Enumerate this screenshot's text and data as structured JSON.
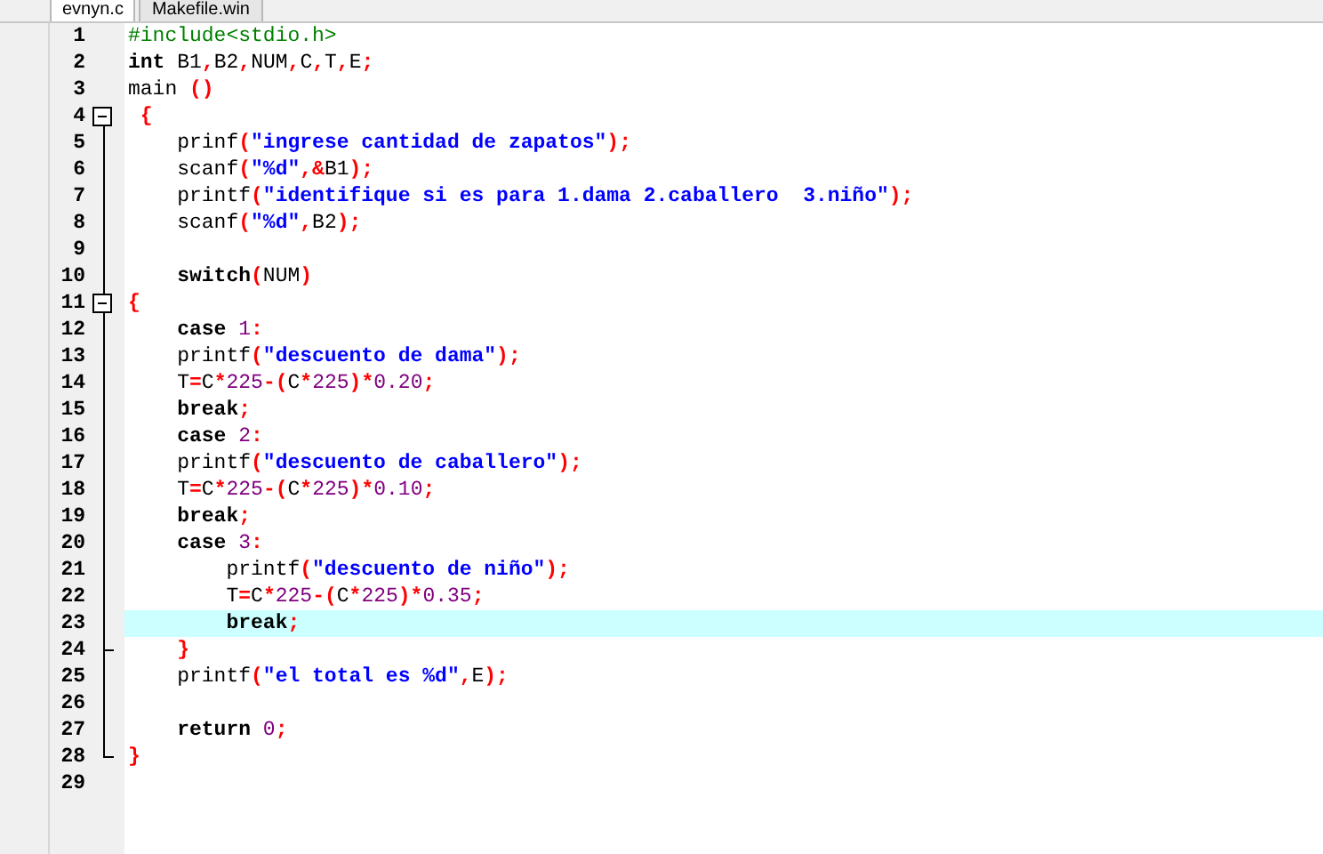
{
  "tabs": [
    {
      "label": "evnyn.c",
      "selected": true
    },
    {
      "label": "Makefile.win",
      "selected": false
    }
  ],
  "editor": {
    "lines": [
      {
        "number": "1",
        "kind": "code",
        "highlighted": false,
        "tokens": [
          {
            "kind": "preproc",
            "text": "#include<stdio.h>"
          }
        ]
      },
      {
        "number": "2",
        "kind": "code",
        "highlighted": false,
        "tokens": [
          {
            "kind": "keyword",
            "text": "int"
          },
          {
            "kind": "plain",
            "text": " B1"
          },
          {
            "kind": "symbol",
            "text": ","
          },
          {
            "kind": "plain",
            "text": "B2"
          },
          {
            "kind": "symbol",
            "text": ","
          },
          {
            "kind": "plain",
            "text": "NUM"
          },
          {
            "kind": "symbol",
            "text": ","
          },
          {
            "kind": "plain",
            "text": "C"
          },
          {
            "kind": "symbol",
            "text": ","
          },
          {
            "kind": "plain",
            "text": "T"
          },
          {
            "kind": "symbol",
            "text": ","
          },
          {
            "kind": "plain",
            "text": "E"
          },
          {
            "kind": "symbol",
            "text": ";"
          }
        ]
      },
      {
        "number": "3",
        "kind": "code",
        "highlighted": false,
        "tokens": [
          {
            "kind": "plain",
            "text": "main "
          },
          {
            "kind": "symbol",
            "text": "()"
          }
        ]
      },
      {
        "number": "4",
        "kind": "fold_start",
        "highlighted": false,
        "tokens": [
          {
            "kind": "symbol",
            "text": " {"
          }
        ]
      },
      {
        "number": "5",
        "kind": "code",
        "highlighted": false,
        "tokens": [
          {
            "kind": "plain",
            "text": "    prinf"
          },
          {
            "kind": "symbol",
            "text": "("
          },
          {
            "kind": "string",
            "text": "\"ingrese cantidad de zapatos\""
          },
          {
            "kind": "symbol",
            "text": ");"
          }
        ]
      },
      {
        "number": "6",
        "kind": "code",
        "highlighted": false,
        "tokens": [
          {
            "kind": "plain",
            "text": "    scanf"
          },
          {
            "kind": "symbol",
            "text": "("
          },
          {
            "kind": "string",
            "text": "\"%d\""
          },
          {
            "kind": "symbol",
            "text": ",&"
          },
          {
            "kind": "plain",
            "text": "B1"
          },
          {
            "kind": "symbol",
            "text": ");"
          }
        ]
      },
      {
        "number": "7",
        "kind": "code",
        "highlighted": false,
        "tokens": [
          {
            "kind": "plain",
            "text": "    printf"
          },
          {
            "kind": "symbol",
            "text": "("
          },
          {
            "kind": "string",
            "text": "\"identifique si es para 1.dama 2.caballero  3.niño\""
          },
          {
            "kind": "symbol",
            "text": ");"
          }
        ]
      },
      {
        "number": "8",
        "kind": "code",
        "highlighted": false,
        "tokens": [
          {
            "kind": "plain",
            "text": "    scanf"
          },
          {
            "kind": "symbol",
            "text": "("
          },
          {
            "kind": "string",
            "text": "\"%d\""
          },
          {
            "kind": "symbol",
            "text": ","
          },
          {
            "kind": "plain",
            "text": "B2"
          },
          {
            "kind": "symbol",
            "text": ");"
          }
        ]
      },
      {
        "number": "9",
        "kind": "code",
        "highlighted": false
      },
      {
        "number": "10",
        "kind": "code",
        "highlighted": false,
        "tokens": [
          {
            "kind": "keyword",
            "text": "    switch"
          },
          {
            "kind": "symbol",
            "text": "("
          },
          {
            "kind": "plain",
            "text": "NUM"
          },
          {
            "kind": "symbol",
            "text": ")"
          }
        ]
      },
      {
        "number": "11",
        "kind": "fold_start",
        "highlighted": false,
        "tokens": [
          {
            "kind": "symbol",
            "text": "{"
          }
        ]
      },
      {
        "number": "12",
        "kind": "code",
        "highlighted": false,
        "tokens": [
          {
            "kind": "keyword",
            "text": "    case"
          },
          {
            "kind": "number",
            "text": " 1"
          },
          {
            "kind": "symbol",
            "text": ":"
          }
        ]
      },
      {
        "number": "13",
        "kind": "code",
        "highlighted": false,
        "tokens": [
          {
            "kind": "plain",
            "text": "    printf"
          },
          {
            "kind": "symbol",
            "text": "("
          },
          {
            "kind": "string",
            "text": "\"descuento de dama\""
          },
          {
            "kind": "symbol",
            "text": ");"
          }
        ]
      },
      {
        "number": "14",
        "kind": "code",
        "highlighted": false,
        "tokens": [
          {
            "kind": "plain",
            "text": "    T"
          },
          {
            "kind": "symbol",
            "text": "="
          },
          {
            "kind": "plain",
            "text": "C"
          },
          {
            "kind": "symbol",
            "text": "*"
          },
          {
            "kind": "number",
            "text": "225"
          },
          {
            "kind": "symbol",
            "text": "-("
          },
          {
            "kind": "plain",
            "text": "C"
          },
          {
            "kind": "symbol",
            "text": "*"
          },
          {
            "kind": "number",
            "text": "225"
          },
          {
            "kind": "symbol",
            "text": ")*"
          },
          {
            "kind": "number",
            "text": "0.20"
          },
          {
            "kind": "symbol",
            "text": ";"
          }
        ]
      },
      {
        "number": "15",
        "kind": "code",
        "highlighted": false,
        "tokens": [
          {
            "kind": "keyword",
            "text": "    break"
          },
          {
            "kind": "symbol",
            "text": ";"
          }
        ]
      },
      {
        "number": "16",
        "kind": "code",
        "highlighted": false,
        "tokens": [
          {
            "kind": "keyword",
            "text": "    case"
          },
          {
            "kind": "number",
            "text": " 2"
          },
          {
            "kind": "symbol",
            "text": ":"
          }
        ]
      },
      {
        "number": "17",
        "kind": "code",
        "highlighted": false,
        "tokens": [
          {
            "kind": "plain",
            "text": "    printf"
          },
          {
            "kind": "symbol",
            "text": "("
          },
          {
            "kind": "string",
            "text": "\"descuento de caballero\""
          },
          {
            "kind": "symbol",
            "text": ");"
          }
        ]
      },
      {
        "number": "18",
        "kind": "code",
        "highlighted": false,
        "tokens": [
          {
            "kind": "plain",
            "text": "    T"
          },
          {
            "kind": "symbol",
            "text": "="
          },
          {
            "kind": "plain",
            "text": "C"
          },
          {
            "kind": "symbol",
            "text": "*"
          },
          {
            "kind": "number",
            "text": "225"
          },
          {
            "kind": "symbol",
            "text": "-("
          },
          {
            "kind": "plain",
            "text": "C"
          },
          {
            "kind": "symbol",
            "text": "*"
          },
          {
            "kind": "number",
            "text": "225"
          },
          {
            "kind": "symbol",
            "text": ")*"
          },
          {
            "kind": "number",
            "text": "0.10"
          },
          {
            "kind": "symbol",
            "text": ";"
          }
        ]
      },
      {
        "number": "19",
        "kind": "code",
        "highlighted": false,
        "tokens": [
          {
            "kind": "keyword",
            "text": "    break"
          },
          {
            "kind": "symbol",
            "text": ";"
          }
        ]
      },
      {
        "number": "20",
        "kind": "code",
        "highlighted": false,
        "tokens": [
          {
            "kind": "keyword",
            "text": "    case"
          },
          {
            "kind": "number",
            "text": " 3"
          },
          {
            "kind": "symbol",
            "text": ":"
          }
        ]
      },
      {
        "number": "21",
        "kind": "code",
        "highlighted": false,
        "tokens": [
          {
            "kind": "plain",
            "text": "        printf"
          },
          {
            "kind": "symbol",
            "text": "("
          },
          {
            "kind": "string",
            "text": "\"descuento de niño\""
          },
          {
            "kind": "symbol",
            "text": ");"
          }
        ]
      },
      {
        "number": "22",
        "kind": "code",
        "highlighted": false,
        "tokens": [
          {
            "kind": "plain",
            "text": "        T"
          },
          {
            "kind": "symbol",
            "text": "="
          },
          {
            "kind": "plain",
            "text": "C"
          },
          {
            "kind": "symbol",
            "text": "*"
          },
          {
            "kind": "number",
            "text": "225"
          },
          {
            "kind": "symbol",
            "text": "-("
          },
          {
            "kind": "plain",
            "text": "C"
          },
          {
            "kind": "symbol",
            "text": "*"
          },
          {
            "kind": "number",
            "text": "225"
          },
          {
            "kind": "symbol",
            "text": ")*"
          },
          {
            "kind": "number",
            "text": "0.35"
          },
          {
            "kind": "symbol",
            "text": ";"
          }
        ]
      },
      {
        "number": "23",
        "kind": "code",
        "highlighted": true,
        "tokens": [
          {
            "kind": "keyword",
            "text": "        break"
          },
          {
            "kind": "symbol",
            "text": ";"
          }
        ]
      },
      {
        "number": "24",
        "kind": "fold_end",
        "highlighted": false,
        "tokens": [
          {
            "kind": "symbol",
            "text": "    }"
          }
        ]
      },
      {
        "number": "25",
        "kind": "code",
        "highlighted": false,
        "tokens": [
          {
            "kind": "plain",
            "text": "    printf"
          },
          {
            "kind": "symbol",
            "text": "("
          },
          {
            "kind": "string",
            "text": "\"el total es %d\""
          },
          {
            "kind": "symbol",
            "text": ","
          },
          {
            "kind": "plain",
            "text": "E"
          },
          {
            "kind": "symbol",
            "text": ");"
          }
        ]
      },
      {
        "number": "26",
        "kind": "code",
        "highlighted": false
      },
      {
        "number": "27",
        "kind": "code",
        "highlighted": false,
        "tokens": [
          {
            "kind": "keyword",
            "text": "    return"
          },
          {
            "kind": "number",
            "text": " 0"
          },
          {
            "kind": "symbol",
            "text": ";"
          }
        ]
      },
      {
        "number": "28",
        "kind": "fold_end",
        "highlighted": false,
        "tokens": [
          {
            "kind": "symbol",
            "text": "}"
          }
        ]
      },
      {
        "number": "29",
        "kind": "code",
        "highlighted": false
      }
    ]
  }
}
